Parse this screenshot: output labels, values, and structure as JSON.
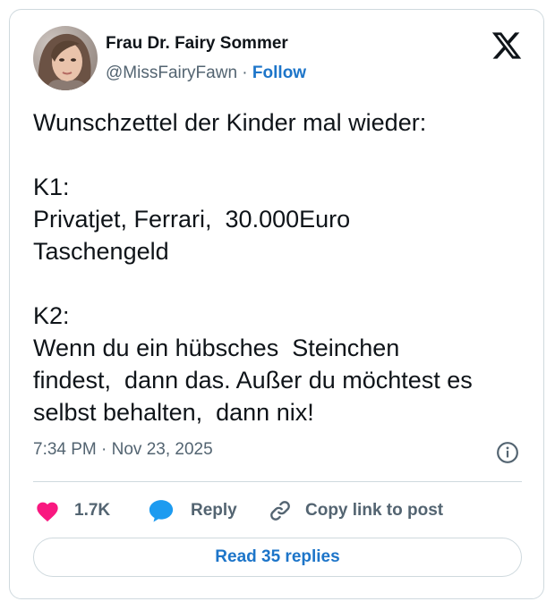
{
  "author": {
    "display_name": "Frau Dr. Fairy Sommer",
    "handle": "@MissFairyFawn",
    "separator": " · ",
    "follow_label": "Follow"
  },
  "post": {
    "text": "Wunschzettel der Kinder mal wieder:\n\nK1:\nPrivatjet, Ferrari,  30.000Euro\nTaschengeld\n\nK2:\nWenn du ein hübsches  Steinchen\nfindest,  dann das. Außer du möchtest es\nselbst behalten,  dann nix!",
    "timestamp": "7:34 PM · Nov 23, 2025"
  },
  "actions": {
    "like_count": "1.7K",
    "reply_label": "Reply",
    "copy_link_label": "Copy link to post"
  },
  "read_replies_label": "Read 35 replies",
  "colors": {
    "like": "#f91880",
    "reply": "#1d9bf0",
    "link": "#1d75c9",
    "secondary_text": "#536471",
    "border": "#cfd9de"
  },
  "icons": [
    "x-logo-icon",
    "info-icon",
    "heart-icon",
    "speech-bubble-icon",
    "link-icon"
  ]
}
